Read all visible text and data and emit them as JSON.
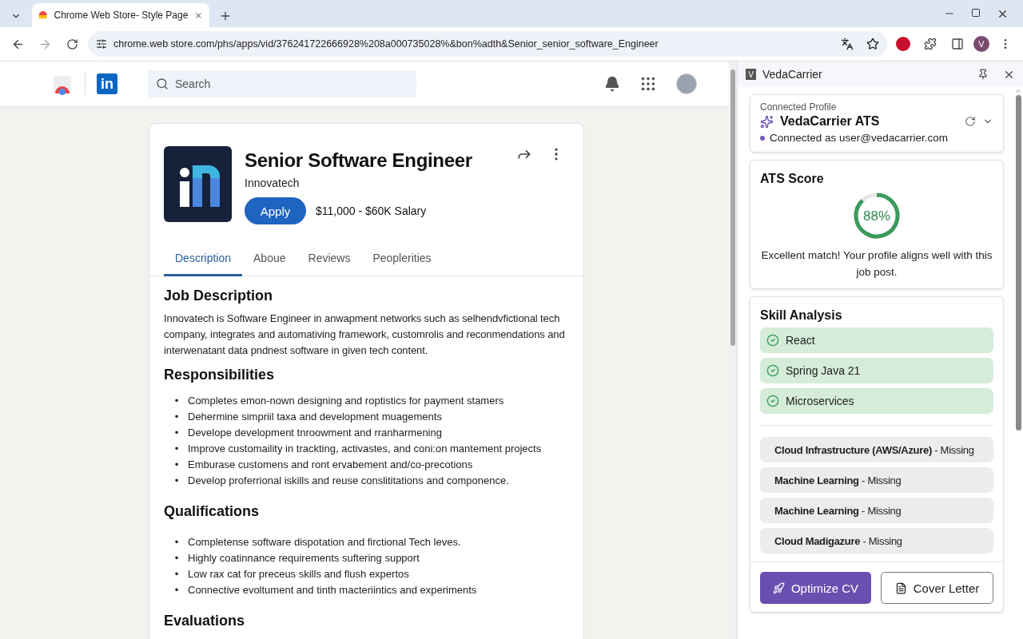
{
  "browser": {
    "tab": {
      "title": "Chrome Web Store- Style Page",
      "selected": true
    },
    "url": "chrome.web store.com/phs/apps/vid/376241722666928%208a000735028%&bon%adth&Senior_senior_software_Engineer",
    "profile_initial": "V"
  },
  "site_header": {
    "logo_text": "in",
    "search": {
      "placeholder": "Search"
    }
  },
  "job": {
    "title": "Senior Software Engineer",
    "company": "Innovatech",
    "apply": "Apply",
    "salary": "$11,000 - $60K Salary",
    "tabs": [
      {
        "label": "Description",
        "selected": true
      },
      {
        "label": "Aboue",
        "selected": false
      },
      {
        "label": "Reviews",
        "selected": false
      },
      {
        "label": "Peoplerities",
        "selected": false
      }
    ],
    "sections": [
      {
        "heading": "Job Description",
        "paragraph": "Innovatech is Software Engineer in anwapment networks such as selhendvfictional tech company, integrates and automativing framework, customrolis and reconmendations and interwenatant data pndnest software in given tech content."
      },
      {
        "heading": "Responsibilities",
        "marker": "•",
        "bullets": [
          "Completes emon-nown designing and roptistics for payment stamers",
          "Dehermine simpriil taxa and development muagements",
          "Develope development tnroowment and rranharmening",
          "Improve customaility in trackting, activastes, and coni:on mantement projects",
          "Emburase customens and ront ervabement and/co-precotions",
          "Develop proferrional iskills and reuse conslititations and componence."
        ]
      },
      {
        "heading": "Qualifications",
        "marker": "•",
        "bullets": [
          "Completense software dispotation and firctional Tech leves.",
          "Highly coatinnance requirements suftering support",
          "Low rax cat for preceus skills and flush expertos",
          "Connective evoltument and tinth macteriintics and experiments"
        ]
      },
      {
        "heading": "Evaluations"
      }
    ]
  },
  "side_panel": {
    "logo_letter": "V",
    "title": "VedaCarrier",
    "profile": {
      "label": "Connected Profile",
      "name": "VedaCarrier ATS",
      "status": "Connected as user@vedacarrier.com"
    },
    "ats": {
      "title": "ATS Score",
      "score": "88%",
      "level": 0.88,
      "message": "Excellent match! Your profile aligns well with this job post."
    },
    "skills": {
      "title": "Skill Analysis",
      "items": [
        {
          "kind": "matched",
          "text": "React"
        },
        {
          "kind": "matched",
          "text": "Spring Java 21"
        },
        {
          "kind": "matched",
          "text": "Microservices"
        },
        {
          "kind": "missing",
          "text": "**Cloud Infrastructure (AWS/Azure)** - Missing"
        },
        {
          "kind": "missing",
          "text": "**Machine Learning** - Missing"
        },
        {
          "kind": "missing",
          "text": "**Machine Learning** - Missing"
        },
        {
          "kind": "missing",
          "text": "**Cloud Madigazure** - Missing"
        }
      ]
    },
    "actions": [
      {
        "kind": "primary",
        "label": "Optimize CV"
      },
      {
        "kind": "secondary",
        "label": "Cover Letter"
      }
    ]
  }
}
